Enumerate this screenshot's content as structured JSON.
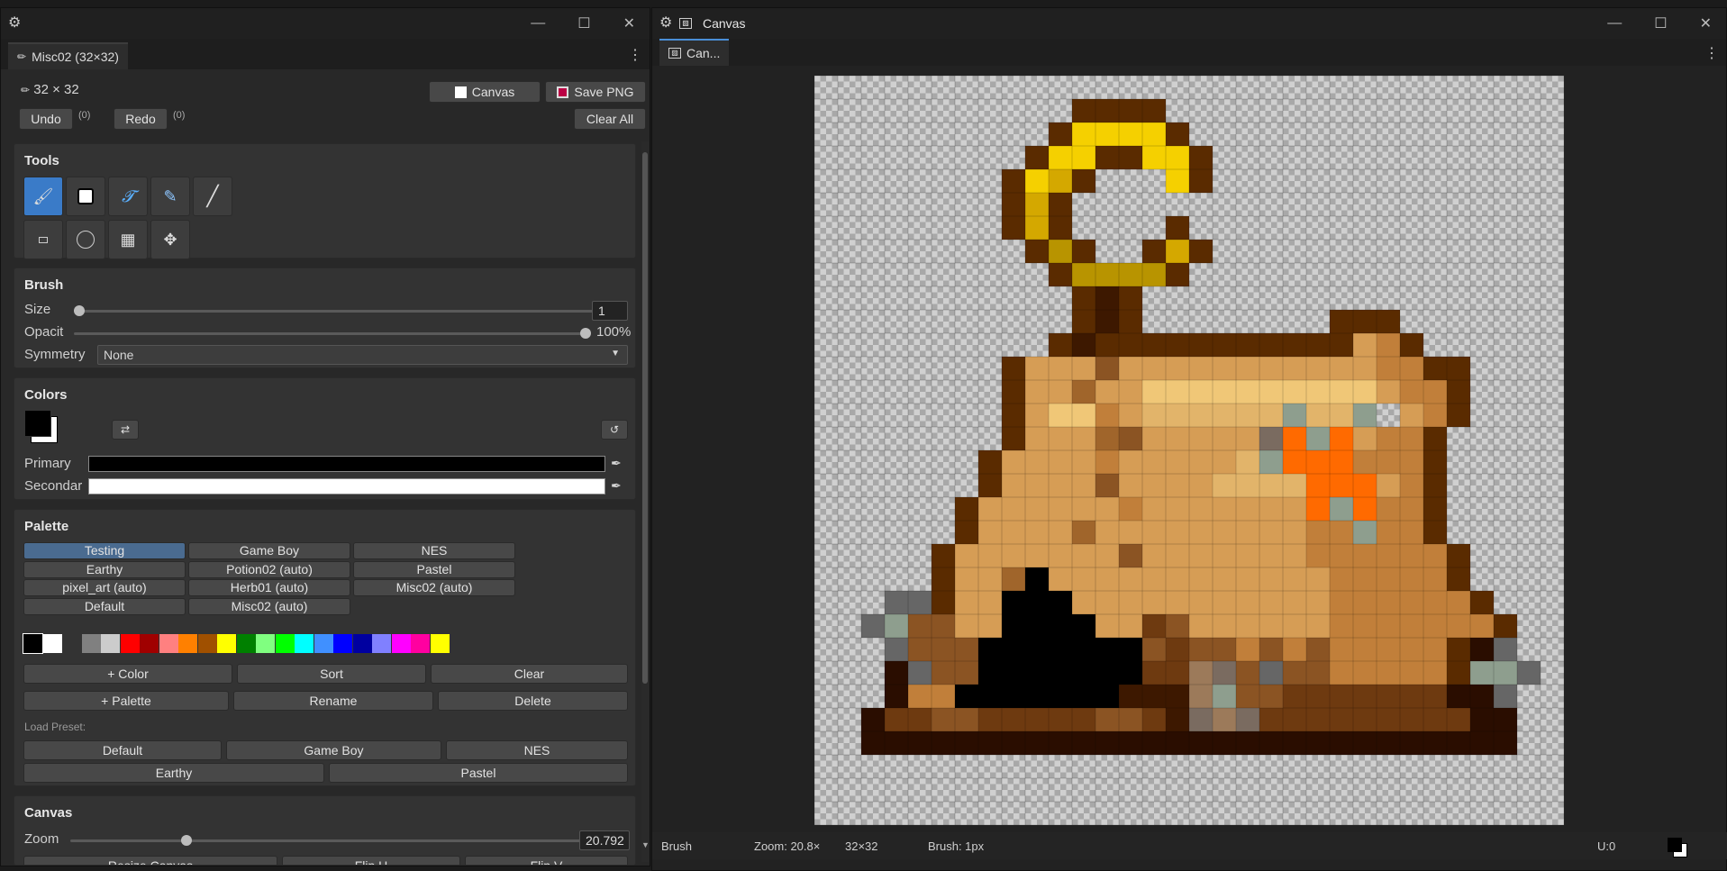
{
  "left_window": {
    "tab_label": "Misc02 (32×32)",
    "size_label": "32 × 32",
    "undo_label": "Undo",
    "undo_count": "(0)",
    "redo_label": "Redo",
    "redo_count": "(0)",
    "canvas_button": "Canvas",
    "save_button": "Save PNG",
    "clear_all_button": "Clear All",
    "tools": {
      "title": "Tools",
      "items": [
        "brush-icon",
        "fill-square-icon",
        "pen-tool-icon",
        "eraser-icon",
        "line-icon",
        "rectangle-icon",
        "ellipse-icon",
        "grid-icon",
        "move-icon"
      ]
    },
    "brush": {
      "title": "Brush",
      "size_label": "Size",
      "size_value": "1",
      "size_fraction": 0.0,
      "opacity_label": "Opacit",
      "opacity_value": "100%",
      "opacity_fraction": 1.0,
      "symmetry_label": "Symmetry",
      "symmetry_value": "None"
    },
    "colors": {
      "title": "Colors",
      "primary_label": "Primary",
      "secondary_label": "Secondar",
      "primary_color": "#000000",
      "secondary_color": "#ffffff"
    },
    "palette": {
      "title": "Palette",
      "presets": [
        "Testing",
        "Game Boy",
        "NES",
        "Earthy",
        "Potion02 (auto)",
        "Pastel",
        "pixel_art (auto)",
        "Herb01 (auto)",
        "Misc02 (auto)",
        "Default",
        "Misc02 (auto)"
      ],
      "swatches": [
        "#000000",
        "#ffffff",
        "#333333",
        "#808080",
        "#cccccc",
        "#ff0000",
        "#a00000",
        "#ff8080",
        "#ff8000",
        "#a05000",
        "#ffff00",
        "#008000",
        "#80ff80",
        "#00ff00",
        "#00ffff",
        "#4090ff",
        "#0000ff",
        "#0000a0",
        "#8080ff",
        "#ff00ff",
        "#ff00a0",
        "#ffff00"
      ],
      "add_color": "+ Color",
      "sort": "Sort",
      "clear": "Clear",
      "add_palette": "+ Palette",
      "rename": "Rename",
      "delete": "Delete",
      "load_preset_label": "Load Preset:",
      "load_presets": [
        "Default",
        "Game Boy",
        "NES",
        "Earthy",
        "Pastel"
      ]
    },
    "canvas": {
      "title": "Canvas",
      "zoom_label": "Zoom",
      "zoom_value": "20.792",
      "zoom_fraction": 0.22,
      "bottom_buttons": [
        "Resize Canvas",
        "Flip H",
        "Flip V"
      ]
    }
  },
  "right_window": {
    "title": "Canvas",
    "tab_label": "Can...",
    "status": {
      "tool": "Brush",
      "zoom": "Zoom: 20.8×",
      "size": "32×32",
      "brush": "Brush: 1px",
      "undo": "U:0"
    }
  },
  "pixel_art": {
    "palette_key": {
      "k": "#3d1800",
      "d": "#5a2b00",
      "b": "#6e3a10",
      "m": "#8b5423",
      "t": "#a0652b",
      "o": "#c17f3a",
      "l": "#d69d55",
      "p": "#e2b46a",
      "s": "#f0c777",
      "y": "#f5d000",
      "g": "#d4a800",
      "h": "#b89400",
      "x": "#000000",
      "r": "#ff6a00",
      "q": "#8e9e8e",
      "w": "#666666",
      "v": "#7a6b60",
      "n": "#2a0d00",
      "c": "#9c7a5a",
      "e": "#ad8560"
    },
    "rows": [
      "................................",
      "...........dddd.................",
      "..........dyyyyd................",
      ".........dyyddyyd...............",
      "........dygd...yd...............",
      "........dgd.....................",
      "........dgd....d................",
      ".........dhd..dgd...............",
      "..........dhhhhd................",
      "...........dkd..................",
      "...........dkd........ddd.......",
      "..........dkdddddddddddlod......",
      "........dlllmllllllllllloodd....",
      "........dlltllsssssssssslood....",
      "........dlssolppppppqppq.lod....",
      "........dllltmlllllvrqrlood.....",
      ".......dllllolllllpqrrroood.....",
      ".......dllllmllllpppprrrlod.....",
      "......dllllllolllllllrqrood.....",
      "......dlllltlllllllllooqood.....",
      ".....dlllllllmlllllllooooood....",
      ".....dlltxlllllllllllloooood....",
      "...wwdllxxxlllllllllllooooood...",
      "..wqmmllxxxxllbmlllllloooooood..",
      "...wmmmxxxxxxxmbmmomomooooodnw..",
      "...nwmmxxxxxxxbbcvmwmmooooodqqw.",
      "...nooxxxxxxxkkkcqmmbbbbbbbnnw..",
      "..nbbmmbbbbbmmbkvcvbbbbbbbbbnn..",
      "..nnnnnnnnnnnnnnnnnnnnnnnnnnnn..",
      "................................",
      "................................",
      "................................"
    ]
  }
}
